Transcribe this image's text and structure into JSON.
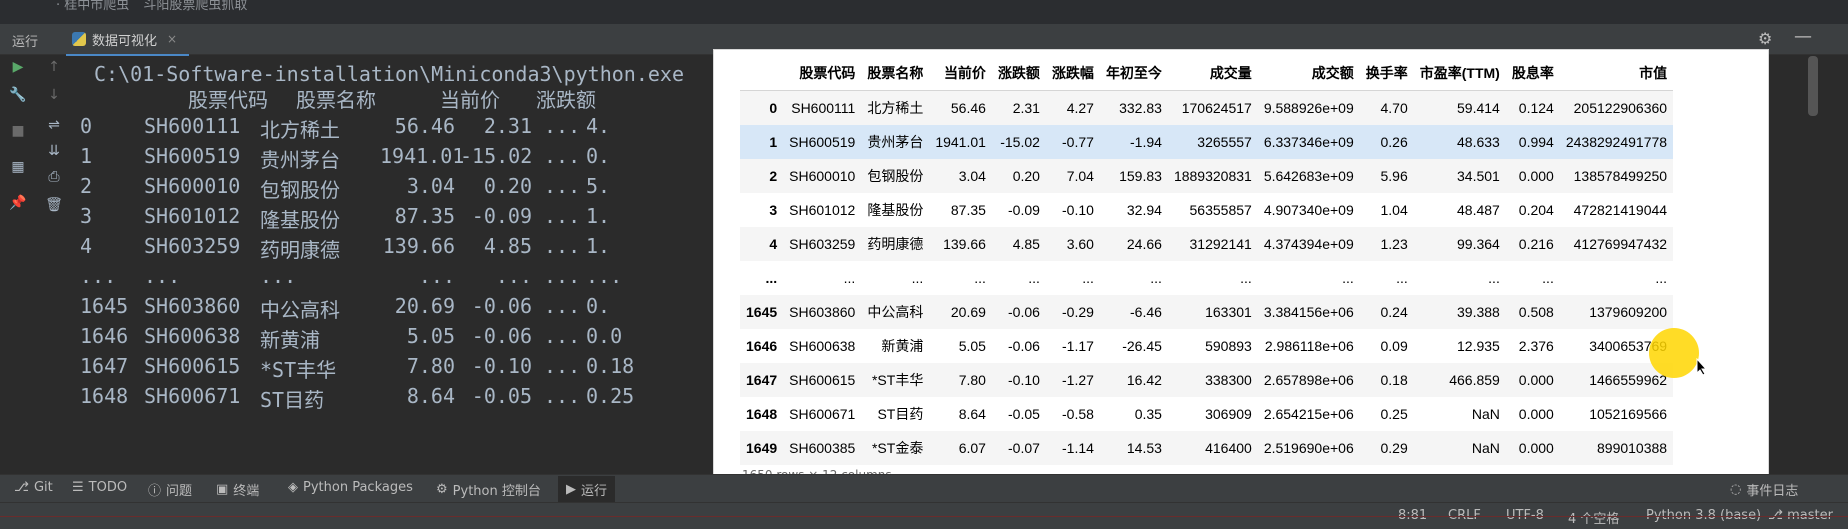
{
  "top_strip": {
    "tree_item_1": "· 桂中市爬虫",
    "tree_item_2": "斗阳股票爬虫抓取"
  },
  "runbar": {
    "title": "运行",
    "tab_label": "数据可视化",
    "close": "×"
  },
  "icons": {
    "run": "play-icon",
    "up": "arrow-up-icon",
    "down": "arrow-down-icon",
    "wrench": "wrench-icon",
    "stop": "stop-icon",
    "wrap": "soft-wrap-icon",
    "scroll": "scroll-to-end-icon",
    "print": "print-icon",
    "layout": "layout-icon",
    "pin": "pin-icon",
    "trash": "trash-icon",
    "gear": "gear-icon",
    "minimize": "minimize-icon"
  },
  "console": {
    "command": "C:\\01-Software-installation\\Miniconda3\\python.exe",
    "header": [
      "股票代码",
      "股票名称",
      "当前价",
      "涨跌额"
    ],
    "rows": [
      {
        "idx": "0",
        "code": "SH600111",
        "name": "北方稀土",
        "price": "56.46",
        "chg": "2.31",
        "dots": "...",
        "tail": "4."
      },
      {
        "idx": "1",
        "code": "SH600519",
        "name": "贵州茅台",
        "price": "1941.01",
        "chg": "-15.02",
        "dots": "...",
        "tail": "0."
      },
      {
        "idx": "2",
        "code": "SH600010",
        "name": "包钢股份",
        "price": "3.04",
        "chg": "0.20",
        "dots": "...",
        "tail": "5."
      },
      {
        "idx": "3",
        "code": "SH601012",
        "name": "隆基股份",
        "price": "87.35",
        "chg": "-0.09",
        "dots": "...",
        "tail": "1."
      },
      {
        "idx": "4",
        "code": "SH603259",
        "name": "药明康德",
        "price": "139.66",
        "chg": "4.85",
        "dots": "...",
        "tail": "1."
      },
      {
        "idx": "...",
        "code": "...",
        "name": "...",
        "price": "...",
        "chg": "...",
        "dots": "...",
        "tail": "..."
      },
      {
        "idx": "1645",
        "code": "SH603860",
        "name": "中公高科",
        "price": "20.69",
        "chg": "-0.06",
        "dots": "...",
        "tail": "0."
      },
      {
        "idx": "1646",
        "code": "SH600638",
        "name": "新黄浦",
        "price": "5.05",
        "chg": "-0.06",
        "dots": "...",
        "tail": "0.0"
      },
      {
        "idx": "1647",
        "code": "SH600615",
        "name": "*ST丰华",
        "price": "7.80",
        "chg": "-0.10",
        "dots": "...",
        "tail": "0.18"
      },
      {
        "idx": "1648",
        "code": "SH600671",
        "name": "ST目药",
        "price": "8.64",
        "chg": "-0.05",
        "dots": "...",
        "tail": "0.25"
      }
    ]
  },
  "table": {
    "columns": [
      "",
      "股票代码",
      "股票名称",
      "当前价",
      "涨跌额",
      "涨跌幅",
      "年初至今",
      "成交量",
      "成交额",
      "换手率",
      "市盈率(TTM)",
      "股息率",
      "市值"
    ],
    "rows": [
      [
        "0",
        "SH600111",
        "北方稀土",
        "56.46",
        "2.31",
        "4.27",
        "332.83",
        "170624517",
        "9.588926e+09",
        "4.70",
        "59.414",
        "0.124",
        "205122906360"
      ],
      [
        "1",
        "SH600519",
        "贵州茅台",
        "1941.01",
        "-15.02",
        "-0.77",
        "-1.94",
        "3265557",
        "6.337346e+09",
        "0.26",
        "48.633",
        "0.994",
        "2438292491778"
      ],
      [
        "2",
        "SH600010",
        "包钢股份",
        "3.04",
        "0.20",
        "7.04",
        "159.83",
        "1889320831",
        "5.642683e+09",
        "5.96",
        "34.501",
        "0.000",
        "138578499250"
      ],
      [
        "3",
        "SH601012",
        "隆基股份",
        "87.35",
        "-0.09",
        "-0.10",
        "32.94",
        "56355857",
        "4.907340e+09",
        "1.04",
        "48.487",
        "0.204",
        "472821419044"
      ],
      [
        "4",
        "SH603259",
        "药明康德",
        "139.66",
        "4.85",
        "3.60",
        "24.66",
        "31292141",
        "4.374394e+09",
        "1.23",
        "99.364",
        "0.216",
        "412769947432"
      ],
      [
        "...",
        "...",
        "...",
        "...",
        "...",
        "...",
        "...",
        "...",
        "...",
        "...",
        "...",
        "...",
        "..."
      ],
      [
        "1645",
        "SH603860",
        "中公高科",
        "20.69",
        "-0.06",
        "-0.29",
        "-6.46",
        "163301",
        "3.384156e+06",
        "0.24",
        "39.388",
        "0.508",
        "1379609200"
      ],
      [
        "1646",
        "SH600638",
        "新黄浦",
        "5.05",
        "-0.06",
        "-1.17",
        "-26.45",
        "590893",
        "2.986118e+06",
        "0.09",
        "12.935",
        "2.376",
        "3400653769"
      ],
      [
        "1647",
        "SH600615",
        "*ST丰华",
        "7.80",
        "-0.10",
        "-1.27",
        "16.42",
        "338300",
        "2.657898e+06",
        "0.18",
        "466.859",
        "0.000",
        "1466559962"
      ],
      [
        "1648",
        "SH600671",
        "ST目药",
        "8.64",
        "-0.05",
        "-0.58",
        "0.35",
        "306909",
        "2.654215e+06",
        "0.25",
        "NaN",
        "0.000",
        "1052169566"
      ],
      [
        "1649",
        "SH600385",
        "*ST金泰",
        "6.07",
        "-0.07",
        "-1.14",
        "14.53",
        "416400",
        "2.519690e+06",
        "0.29",
        "NaN",
        "0.000",
        "899010388"
      ]
    ],
    "selected_row_index": 1,
    "bottom_note": "1650 rows × 12 columns"
  },
  "bottom_tools": [
    "Git",
    "TODO",
    "问题",
    "终端",
    "Python Packages",
    "Python 控制台",
    "运行"
  ],
  "event_log": "事件日志",
  "status": {
    "position": "8:81",
    "line_sep": "CRLF",
    "encoding": "UTF-8",
    "indent": "4 个空格",
    "interpreter": "Python 3.8 (base)",
    "branch": "master"
  },
  "colors": {
    "accent": "#4a88c7",
    "highlight": "#ffd600",
    "selected_row": "#d7e7f7",
    "alt_row": "#f5f5f5"
  }
}
